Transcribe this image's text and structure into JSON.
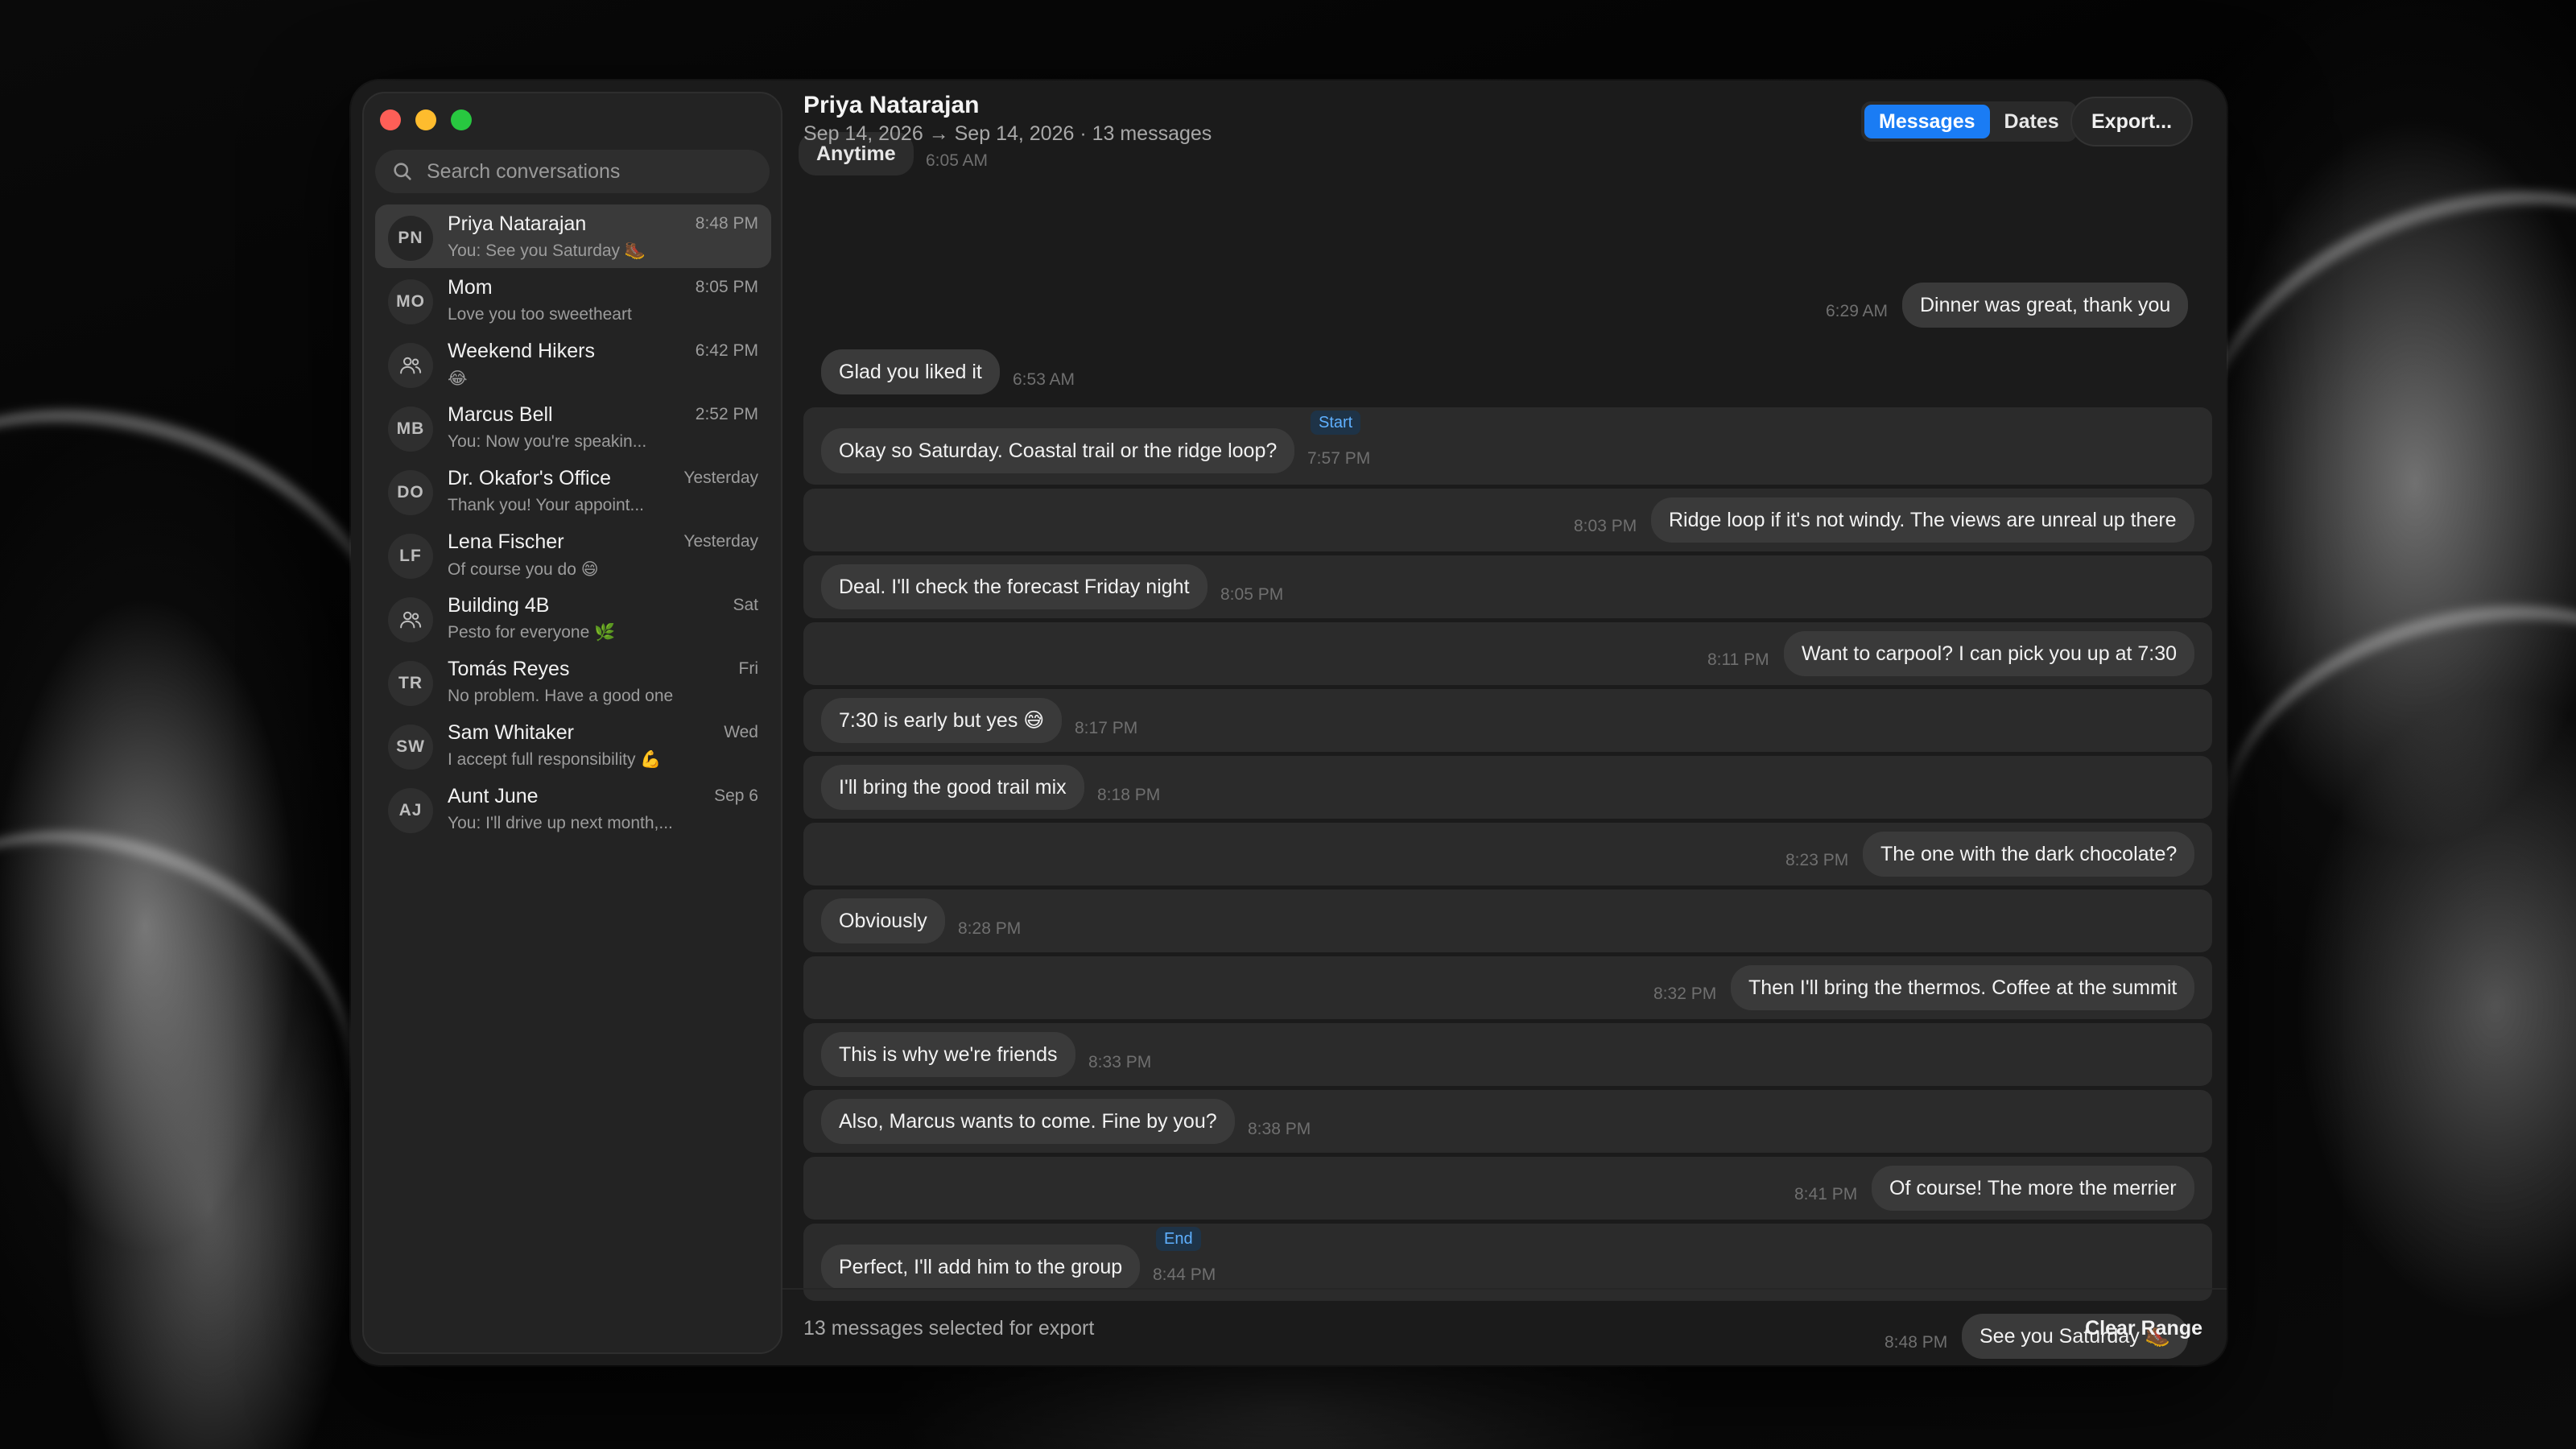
{
  "window_controls": {
    "close": "close",
    "minimize": "minimize",
    "zoom": "zoom"
  },
  "sidebar": {
    "search_placeholder": "Search conversations",
    "conversations": [
      {
        "initials": "PN",
        "name": "Priya Natarajan",
        "preview": "You: See you Saturday 🥾",
        "time": "8:48 PM",
        "active": true,
        "icon": ""
      },
      {
        "initials": "MO",
        "name": "Mom",
        "preview": "Love you too sweetheart",
        "time": "8:05 PM",
        "active": false,
        "icon": ""
      },
      {
        "initials": "",
        "name": "Weekend Hikers",
        "preview": "😂",
        "time": "6:42 PM",
        "active": false,
        "icon": "group-icon"
      },
      {
        "initials": "MB",
        "name": "Marcus Bell",
        "preview": "You: Now you're speakin...",
        "time": "2:52 PM",
        "active": false,
        "icon": ""
      },
      {
        "initials": "DO",
        "name": "Dr. Okafor's Office",
        "preview": "Thank you! Your appoint...",
        "time": "Yesterday",
        "active": false,
        "icon": ""
      },
      {
        "initials": "LF",
        "name": "Lena Fischer",
        "preview": "Of course you do 😄",
        "time": "Yesterday",
        "active": false,
        "icon": ""
      },
      {
        "initials": "",
        "name": "Building 4B",
        "preview": "Pesto for everyone 🌿",
        "time": "Sat",
        "active": false,
        "icon": "group-icon"
      },
      {
        "initials": "TR",
        "name": "Tomás Reyes",
        "preview": "No problem. Have a good one",
        "time": "Fri",
        "active": false,
        "icon": ""
      },
      {
        "initials": "SW",
        "name": "Sam Whitaker",
        "preview": "I accept full responsibility 💪",
        "time": "Wed",
        "active": false,
        "icon": ""
      },
      {
        "initials": "AJ",
        "name": "Aunt June",
        "preview": "You: I'll drive up next month,...",
        "time": "Sep 6",
        "active": false,
        "icon": ""
      }
    ]
  },
  "header": {
    "title": "Priya Natarajan",
    "subtitle": "Sep 14, 2026 → Sep 14, 2026 · 13 messages",
    "tabs": [
      {
        "label": "Messages",
        "active": true
      },
      {
        "label": "Dates",
        "active": false
      }
    ],
    "export_label": "Export..."
  },
  "thread": {
    "anytime_label": "Anytime",
    "anytime_time": "6:05 AM",
    "messages": [
      {
        "text": "Dinner was great, thank you",
        "time": "6:29 AM",
        "from_me": true,
        "in_range": false,
        "marker": ""
      },
      {
        "text": "Glad you liked it",
        "time": "6:53 AM",
        "from_me": false,
        "in_range": false,
        "marker": ""
      },
      {
        "text": "Okay so Saturday. Coastal trail or the ridge loop?",
        "time": "7:57 PM",
        "from_me": false,
        "in_range": true,
        "marker": "Start"
      },
      {
        "text": "Ridge loop if it's not windy. The views are unreal up there",
        "time": "8:03 PM",
        "from_me": true,
        "in_range": true,
        "marker": ""
      },
      {
        "text": "Deal. I'll check the forecast Friday night",
        "time": "8:05 PM",
        "from_me": false,
        "in_range": true,
        "marker": ""
      },
      {
        "text": "Want to carpool? I can pick you up at 7:30",
        "time": "8:11 PM",
        "from_me": true,
        "in_range": true,
        "marker": ""
      },
      {
        "text": "7:30 is early but yes 😅",
        "time": "8:17 PM",
        "from_me": false,
        "in_range": true,
        "marker": ""
      },
      {
        "text": "I'll bring the good trail mix",
        "time": "8:18 PM",
        "from_me": false,
        "in_range": true,
        "marker": ""
      },
      {
        "text": "The one with the dark chocolate?",
        "time": "8:23 PM",
        "from_me": true,
        "in_range": true,
        "marker": ""
      },
      {
        "text": "Obviously",
        "time": "8:28 PM",
        "from_me": false,
        "in_range": true,
        "marker": ""
      },
      {
        "text": "Then I'll bring the thermos. Coffee at the summit",
        "time": "8:32 PM",
        "from_me": true,
        "in_range": true,
        "marker": ""
      },
      {
        "text": "This is why we're friends",
        "time": "8:33 PM",
        "from_me": false,
        "in_range": true,
        "marker": ""
      },
      {
        "text": "Also, Marcus wants to come. Fine by you?",
        "time": "8:38 PM",
        "from_me": false,
        "in_range": true,
        "marker": ""
      },
      {
        "text": "Of course! The more the merrier",
        "time": "8:41 PM",
        "from_me": true,
        "in_range": true,
        "marker": ""
      },
      {
        "text": "Perfect, I'll add him to the group",
        "time": "8:44 PM",
        "from_me": false,
        "in_range": true,
        "marker": "End"
      },
      {
        "text": "See you Saturday 🥾",
        "time": "8:48 PM",
        "from_me": true,
        "in_range": false,
        "marker": ""
      }
    ]
  },
  "footer": {
    "selection_text": "13 messages selected for export",
    "clear_label": "Clear Range"
  },
  "colors": {
    "accent": "#1a7cf4",
    "marker_text": "#5fb0ff",
    "bubble": "#3a3a3a",
    "range_band": "#2b2b2b"
  }
}
